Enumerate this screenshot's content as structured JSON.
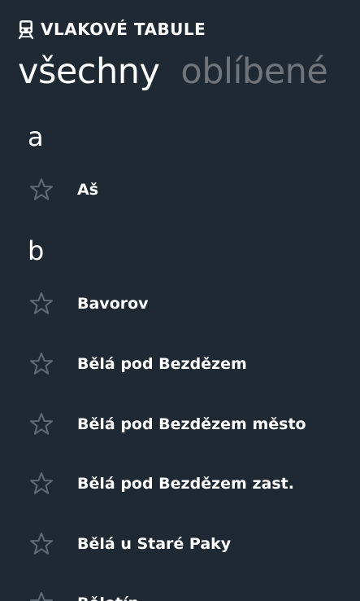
{
  "app": {
    "title": "VLAKOVÉ TABULE",
    "icon": "train-icon"
  },
  "pivot": {
    "tabs": [
      {
        "label": "všechny",
        "active": true
      },
      {
        "label": "oblíbené",
        "active": false
      }
    ]
  },
  "list": {
    "groups": [
      {
        "header": "a",
        "stations": [
          {
            "name": "Aš",
            "favorite": false
          }
        ]
      },
      {
        "header": "b",
        "stations": [
          {
            "name": "Bavorov",
            "favorite": false
          },
          {
            "name": "Bělá pod Bezdězem",
            "favorite": false
          },
          {
            "name": "Bělá pod Bezdězem město",
            "favorite": false
          },
          {
            "name": "Bělá pod Bezdězem zast.",
            "favorite": false
          },
          {
            "name": "Bělá u Staré Paky",
            "favorite": false
          },
          {
            "name": "Bělotín",
            "favorite": false
          }
        ]
      }
    ]
  },
  "colors": {
    "background": "#1f2933",
    "text": "#ffffff",
    "inactive_tab": "#6f757b",
    "star_outline": "#5f6b75"
  }
}
